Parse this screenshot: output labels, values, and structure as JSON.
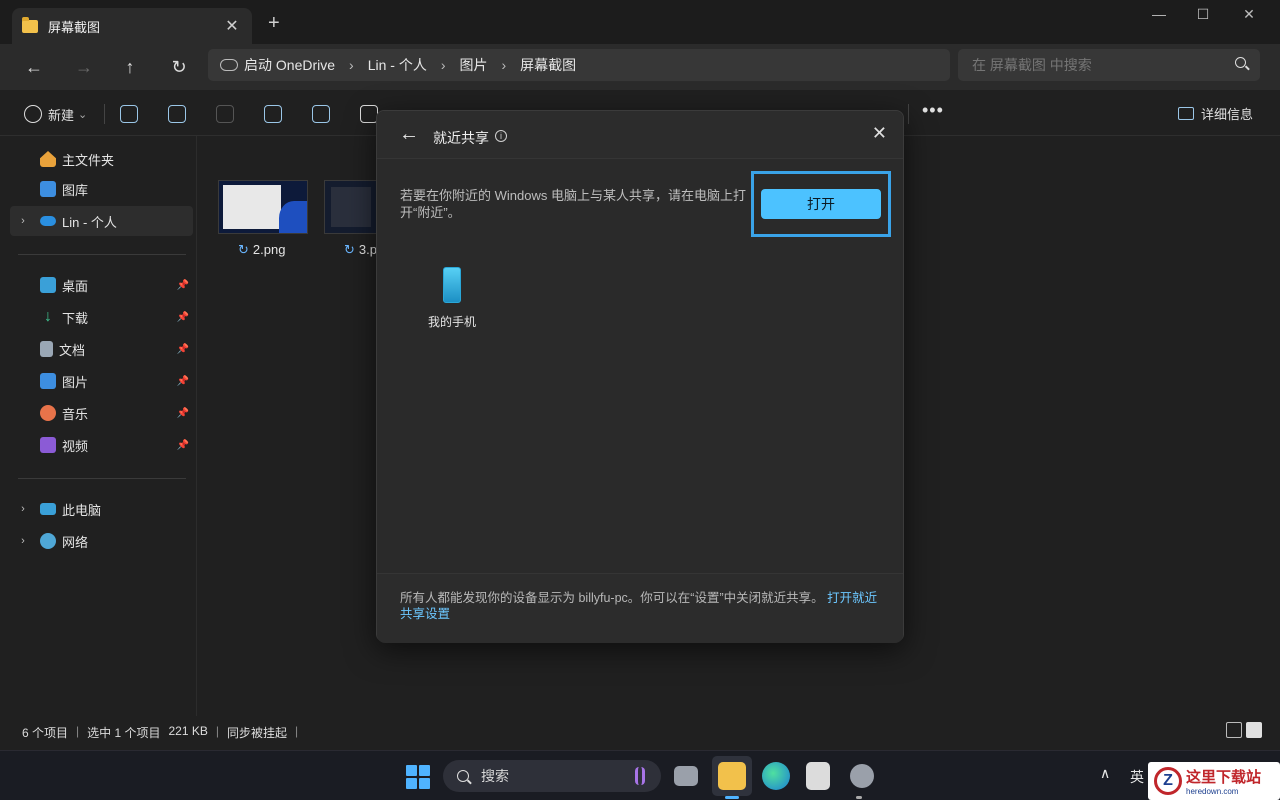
{
  "window": {
    "tab_label": "屏幕截图",
    "tab_close": "✕",
    "new_tab": "+",
    "controls": {
      "minimize": "—",
      "maximize": "☐",
      "close": "✕"
    }
  },
  "nav": {
    "back": "←",
    "forward": "→",
    "up": "↑",
    "refresh": "↻",
    "breadcrumb": [
      "启动 OneDrive",
      "Lin - 个人",
      "图片",
      "屏幕截图"
    ],
    "separator": "›",
    "search_placeholder": "在 屏幕截图 中搜索"
  },
  "toolbar": {
    "new_label": "新建",
    "new_caret": "⌄",
    "more": "•••",
    "details_label": "详细信息"
  },
  "sidebar": {
    "top_items": [
      {
        "label": "主文件夹",
        "icon": "home-icon"
      },
      {
        "label": "图库",
        "icon": "gallery-icon"
      },
      {
        "label": "Lin - 个人",
        "icon": "onedrive-cloud-icon",
        "selected": true,
        "chevron": "›"
      }
    ],
    "pinned_items": [
      {
        "label": "桌面",
        "icon": "desktop-icon"
      },
      {
        "label": "下载",
        "icon": "download-icon"
      },
      {
        "label": "文档",
        "icon": "document-icon"
      },
      {
        "label": "图片",
        "icon": "pictures-icon"
      },
      {
        "label": "音乐",
        "icon": "music-icon"
      },
      {
        "label": "视频",
        "icon": "video-icon"
      }
    ],
    "pin_glyph": "📌",
    "bottom_items": [
      {
        "label": "此电脑",
        "icon": "computer-icon",
        "chevron": "›"
      },
      {
        "label": "网络",
        "icon": "network-icon",
        "chevron": "›"
      }
    ]
  },
  "files": [
    {
      "name": "2.png",
      "sync": "↻"
    },
    {
      "name": "3.p",
      "sync": "↻"
    }
  ],
  "status": {
    "count": "6 个项目",
    "selected": "选中 1 个项目",
    "size": "221 KB",
    "sync": "同步被挂起",
    "divider": "|"
  },
  "dialog": {
    "back": "←",
    "title": "就近共享",
    "info": "i",
    "close": "✕",
    "message": "若要在你附近的 Windows 电脑上与某人共享，请在电脑上打开“附近”。",
    "open_button": "打开",
    "device_name": "我的手机",
    "footer_text": "所有人都能发现你的设备显示为 billyfu-pc。你可以在“设置”中关闭就近共享。",
    "footer_link": "打开就近共享设置"
  },
  "taskbar": {
    "search_label": "搜索",
    "tray_chevron": "∧",
    "ime": "英"
  },
  "watermark": {
    "logo_letter": "Z",
    "cn": "这里下载站",
    "en": "heredown.com"
  },
  "colors": {
    "accent": "#4cc2ff",
    "highlight_box": "#3aa3e8",
    "link": "#6cc7ff",
    "folder": "#f2c14b"
  }
}
